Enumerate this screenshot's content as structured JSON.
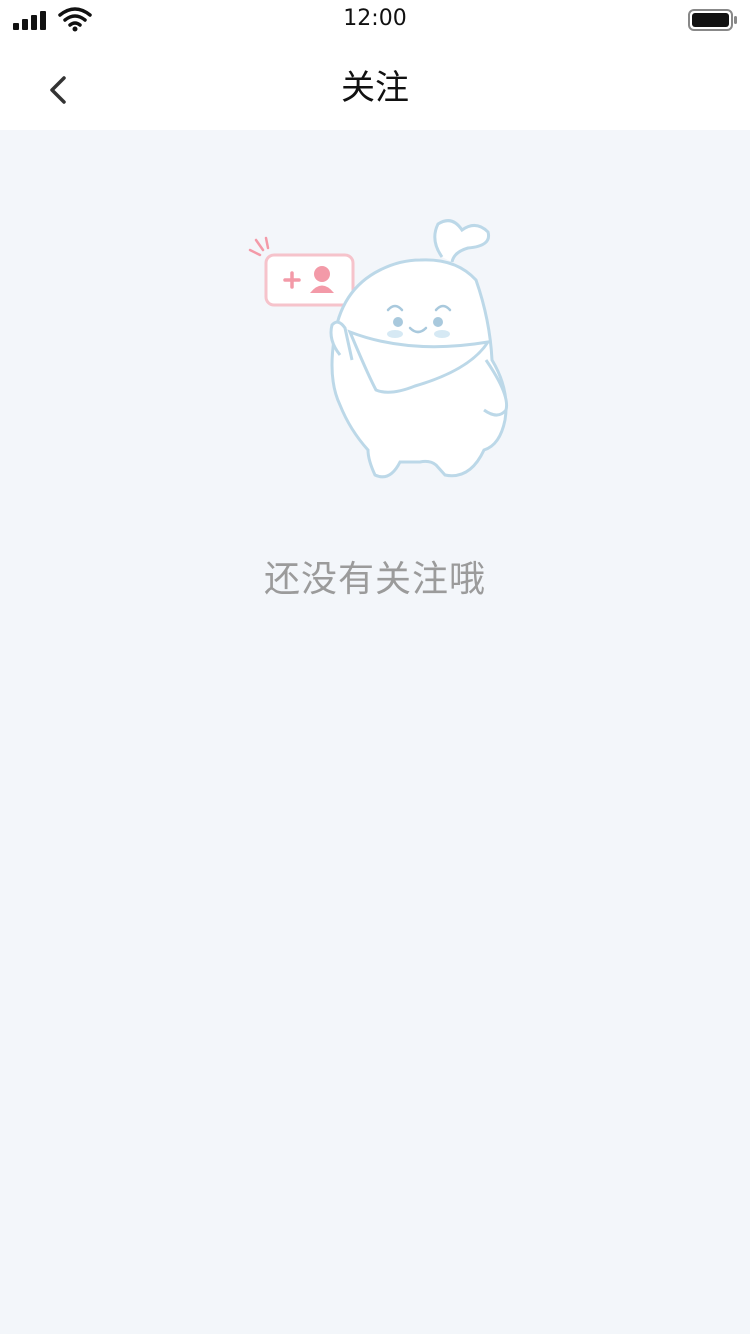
{
  "status_bar": {
    "time": "12:00",
    "signal_icon": "cellular-signal-icon",
    "wifi_icon": "wifi-icon",
    "battery_icon": "battery-icon"
  },
  "nav": {
    "back_icon": "chevron-left-icon",
    "title": "关注"
  },
  "empty_state": {
    "illustration": "mascot-follow-illustration",
    "message": "还没有关注哦"
  },
  "colors": {
    "background": "#f3f6fa",
    "header": "#ffffff",
    "message_text": "#9b9b9b",
    "mascot_outline": "#bcd8e8",
    "badge_pink": "#f39aa8"
  }
}
